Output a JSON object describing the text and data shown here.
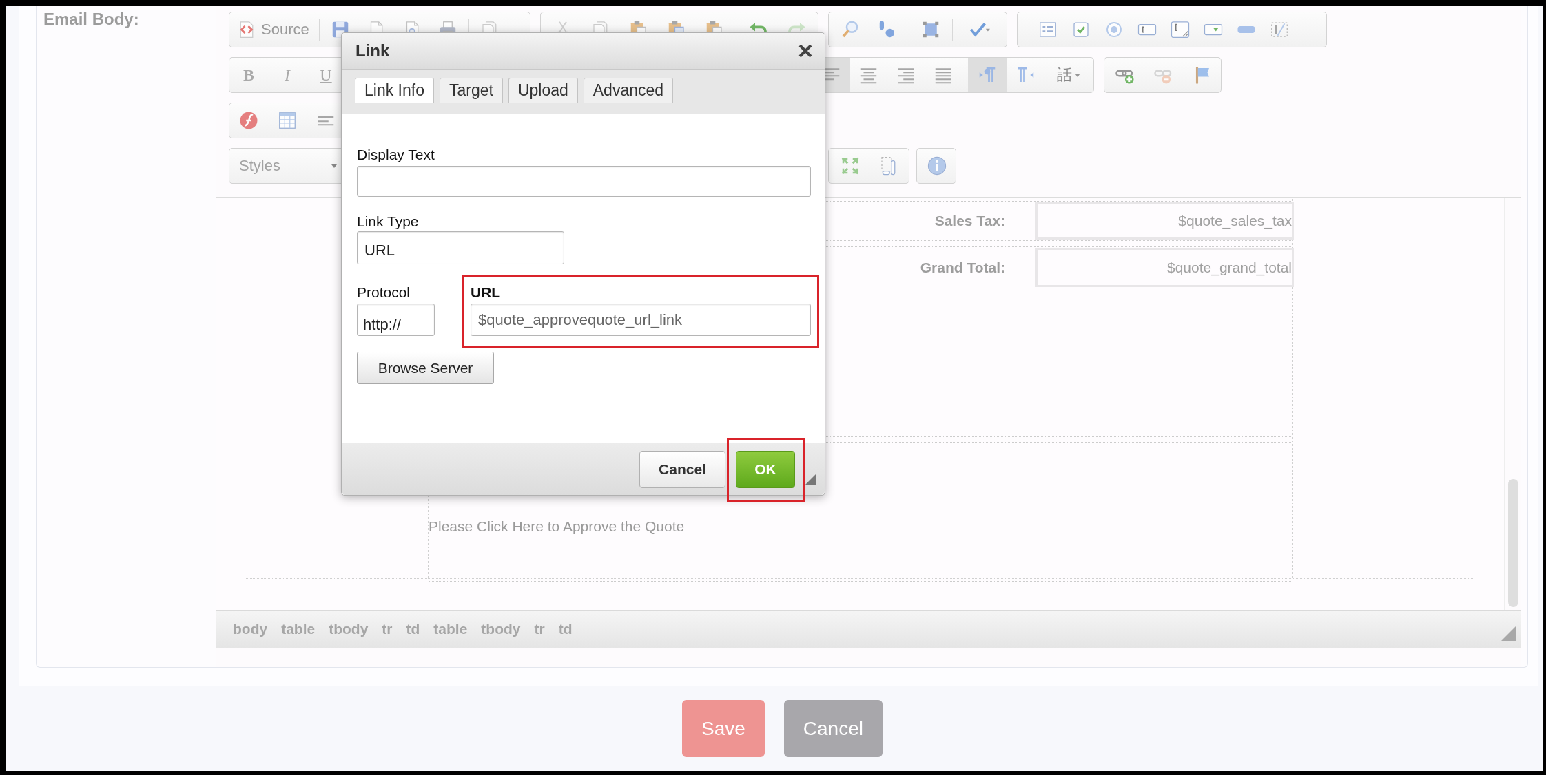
{
  "page": {
    "field_label": "Email Body:"
  },
  "editor": {
    "toolbar": {
      "source_label": "Source",
      "format_buttons": [
        {
          "label": "B"
        },
        {
          "label": "I"
        },
        {
          "label": "U"
        }
      ],
      "align_buttons": [
        {
          "pressed": true
        },
        {
          "pressed": false
        },
        {
          "pressed": false
        },
        {
          "pressed": false
        }
      ],
      "direction_buttons": [
        {
          "pressed": true
        },
        {
          "pressed": false
        }
      ],
      "language_label": "話",
      "styles_placeholder": "Styles"
    },
    "content": {
      "rows": [
        {
          "label": "Sales Tax:",
          "value": "$quote_sales_tax"
        },
        {
          "label": "Grand Total:",
          "value": "$quote_grand_total"
        }
      ],
      "link_text": "Please Click Here to Approve the Quote"
    },
    "element_path": [
      "body",
      "table",
      "tbody",
      "tr",
      "td",
      "table",
      "tbody",
      "tr",
      "td"
    ]
  },
  "dialog": {
    "title": "Link",
    "tabs": [
      {
        "label": "Link Info",
        "selected": true
      },
      {
        "label": "Target",
        "selected": false
      },
      {
        "label": "Upload",
        "selected": false
      },
      {
        "label": "Advanced",
        "selected": false
      }
    ],
    "display_text": {
      "label": "Display Text"
    },
    "link_type": {
      "label": "Link Type",
      "value": "URL"
    },
    "protocol": {
      "label": "Protocol",
      "value": "http://"
    },
    "url": {
      "label": "URL",
      "value": "$quote_approvequote_url_link",
      "highlighted": true
    },
    "browse_button": "Browse Server",
    "buttons": [
      {
        "label": "Cancel",
        "kind": "secondary"
      },
      {
        "label": "OK",
        "kind": "primary",
        "highlighted": true
      }
    ]
  },
  "actions": [
    {
      "label": "Save",
      "kind": "primary"
    },
    {
      "label": "Cancel",
      "kind": "secondary"
    }
  ]
}
